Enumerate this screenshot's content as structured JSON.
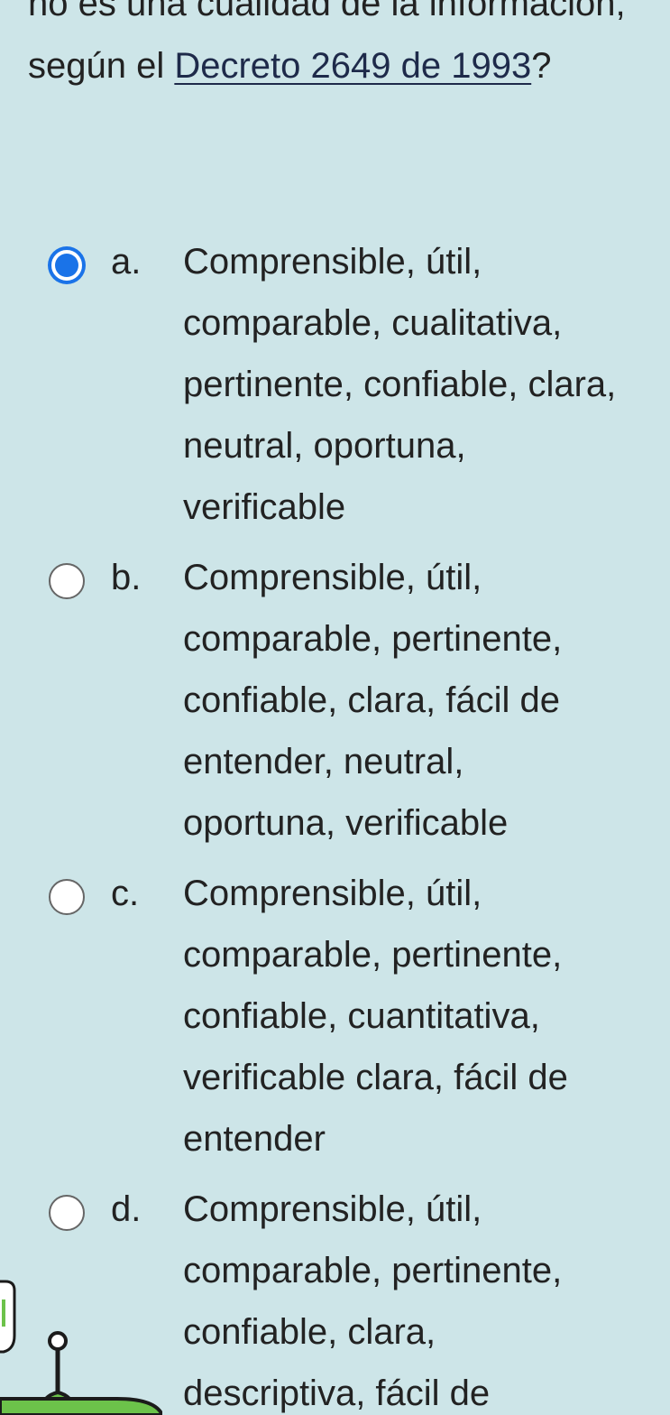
{
  "question": {
    "text_before": "no es una cualidad de la información, según el ",
    "link": "Decreto 2649 de 1993",
    "text_after": "?"
  },
  "options": [
    {
      "letter": "a.",
      "text": "Comprensible, útil, comparable, cualitativa, pertinente, confiable, clara, neutral, oportuna, verificable",
      "selected": true
    },
    {
      "letter": "b.",
      "text": "Comprensible, útil, comparable, pertinente, confiable, clara, fácil de entender, neutral, oportuna, verificable",
      "selected": false
    },
    {
      "letter": "c.",
      "text": "Comprensible, útil, comparable, pertinente, confiable, cuantitativa, verificable clara, fácil de entender",
      "selected": false
    },
    {
      "letter": "d.",
      "text": "Comprensible, útil, comparable, pertinente, confiable, clara, descriptiva, fácil de",
      "selected": false
    }
  ],
  "colors": {
    "background": "#cde5e8",
    "radio_selected": "#1a73e8",
    "link": "#1e2a4a",
    "mascot": "#6cc24a"
  },
  "icons": {
    "mascot": "green-robot-mascot-icon"
  }
}
